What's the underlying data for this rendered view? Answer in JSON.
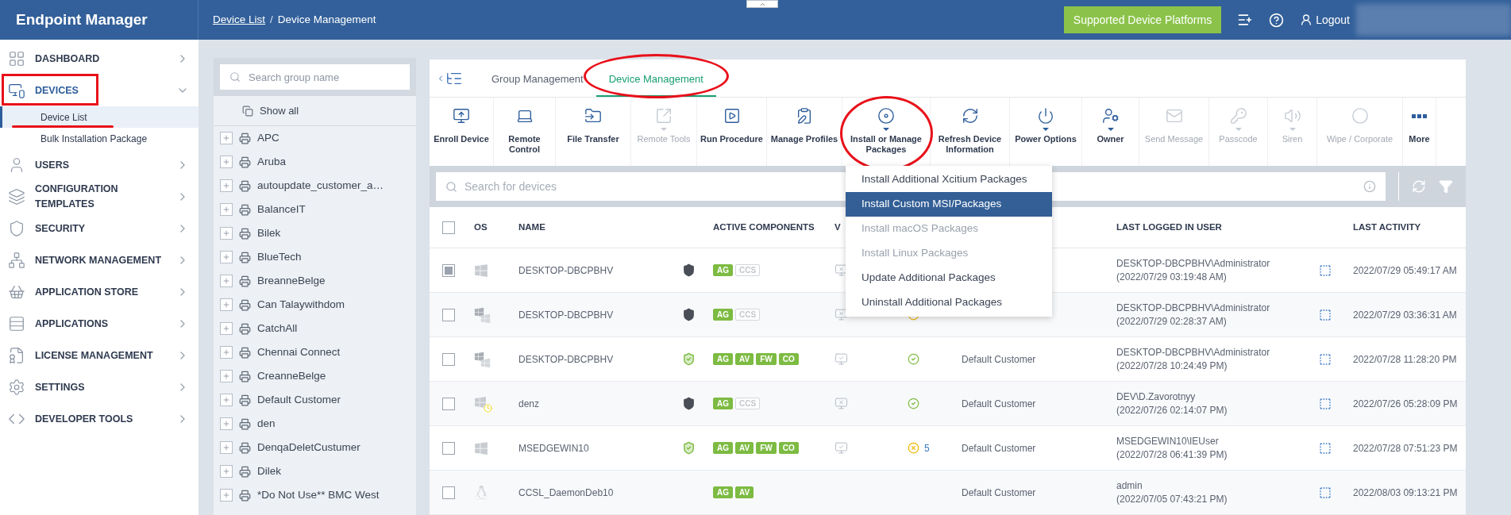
{
  "header": {
    "logo": "Endpoint Manager",
    "breadcrumb": [
      {
        "label": "Device List",
        "link": true
      },
      {
        "label": "Device Management",
        "link": false
      }
    ],
    "separator": "/",
    "platforms_button": "Supported Device Platforms",
    "logout": "Logout"
  },
  "sidebar": {
    "items": [
      {
        "label": "DASHBOARD",
        "selected": false,
        "expanded": false,
        "annotated": false
      },
      {
        "label": "DEVICES",
        "selected": true,
        "expanded": true,
        "annotated": true,
        "children": [
          {
            "label": "Device List",
            "selected": true,
            "annotated": true
          },
          {
            "label": "Bulk Installation Package",
            "selected": false,
            "annotated": false
          }
        ]
      },
      {
        "label": "USERS",
        "selected": false,
        "expanded": false,
        "annotated": false
      },
      {
        "label": "CONFIGURATION TEMPLATES",
        "selected": false,
        "expanded": false,
        "annotated": false
      },
      {
        "label": "SECURITY",
        "selected": false,
        "expanded": false,
        "annotated": false
      },
      {
        "label": "NETWORK MANAGEMENT",
        "selected": false,
        "expanded": false,
        "annotated": false
      },
      {
        "label": "APPLICATION STORE",
        "selected": false,
        "expanded": false,
        "annotated": false
      },
      {
        "label": "APPLICATIONS",
        "selected": false,
        "expanded": false,
        "annotated": false
      },
      {
        "label": "LICENSE MANAGEMENT",
        "selected": false,
        "expanded": false,
        "annotated": false
      },
      {
        "label": "SETTINGS",
        "selected": false,
        "expanded": false,
        "annotated": false
      },
      {
        "label": "DEVELOPER TOOLS",
        "selected": false,
        "expanded": false,
        "annotated": false
      }
    ]
  },
  "groups": {
    "search": {
      "placeholder": "Search group name"
    },
    "show_all": "Show all",
    "items": [
      "APC",
      "Aruba",
      "autoupdate_customer_a…",
      "BalanceIT",
      "Bilek",
      "BlueTech",
      "BreanneBelge",
      "Can Talaywithdom",
      "CatchAll",
      "Chennai Connect",
      "CreanneBelge",
      "Default Customer",
      "den",
      "DenqaDeletCustumer",
      "Dilek",
      "*Do Not Use** BMC West"
    ]
  },
  "tabs": [
    {
      "label": "Group Management",
      "selected": false,
      "annotated": false
    },
    {
      "label": "Device Management",
      "selected": true,
      "annotated": true
    }
  ],
  "toolbar": [
    {
      "label": "Enroll Device",
      "disabled": false,
      "dropdown": false,
      "annotated": false
    },
    {
      "label": "Remote Control",
      "disabled": false,
      "dropdown": false,
      "annotated": false
    },
    {
      "label": "File Transfer",
      "disabled": false,
      "dropdown": false,
      "annotated": false
    },
    {
      "label": "Remote Tools",
      "disabled": true,
      "dropdown": true,
      "annotated": false
    },
    {
      "label": "Run Procedure",
      "disabled": false,
      "dropdown": false,
      "annotated": false
    },
    {
      "label": "Manage Profiles",
      "disabled": false,
      "dropdown": false,
      "annotated": false
    },
    {
      "label": "Install or Manage Packages",
      "disabled": false,
      "dropdown": true,
      "annotated": true
    },
    {
      "label": "Refresh Device Information",
      "disabled": false,
      "dropdown": false,
      "annotated": false
    },
    {
      "label": "Power Options",
      "disabled": false,
      "dropdown": true,
      "annotated": false
    },
    {
      "label": "Owner",
      "disabled": false,
      "dropdown": true,
      "annotated": false
    },
    {
      "label": "Send Message",
      "disabled": true,
      "dropdown": false,
      "annotated": false
    },
    {
      "label": "Passcode",
      "disabled": true,
      "dropdown": true,
      "annotated": false
    },
    {
      "label": "Siren",
      "disabled": true,
      "dropdown": true,
      "annotated": false
    },
    {
      "label": "Wipe / Corporate",
      "disabled": true,
      "dropdown": false,
      "annotated": false
    },
    {
      "label": "More",
      "disabled": false,
      "dropdown": false,
      "annotated": false
    }
  ],
  "device_search": {
    "placeholder": "Search for devices"
  },
  "package_menu": [
    {
      "label": "Install Additional Xcitium Packages",
      "selected": false,
      "disabled": false
    },
    {
      "label": "Install Custom MSI/Packages",
      "selected": true,
      "disabled": false
    },
    {
      "label": "Install macOS Packages",
      "selected": false,
      "disabled": true
    },
    {
      "label": "Install Linux Packages",
      "selected": false,
      "disabled": true
    },
    {
      "label": "Update Additional Packages",
      "selected": false,
      "disabled": false
    },
    {
      "label": "Uninstall Additional Packages",
      "selected": false,
      "disabled": false
    }
  ],
  "table": {
    "select_all_checked": false,
    "columns": {
      "os": "OS",
      "name": "NAME",
      "components": "ACTIVE COMPONENTS",
      "column_6": "V",
      "user": "LAST LOGGED IN USER",
      "activity": "LAST ACTIVITY"
    },
    "rows": [
      {
        "selected": true,
        "os": {
          "kind": "windows"
        },
        "name": "DESKTOP-DBCPBHV",
        "protection": {
          "kind": "partial"
        },
        "components": [
          {
            "label": "AG",
            "active": true
          },
          {
            "label": "CCS",
            "active": false
          }
        ],
        "desktop": {
          "kind": "disconnected"
        },
        "user": "DESKTOP-DBCPBHV\\Administrator",
        "user_time": "(2022/07/29 03:19:48 AM)",
        "activity": "2022/07/29 05:49:17 AM"
      },
      {
        "selected": false,
        "os": {
          "kind": "windows-multi"
        },
        "name": "DESKTOP-DBCPBHV",
        "protection": {
          "kind": "partial"
        },
        "components": [
          {
            "label": "AG",
            "active": true
          },
          {
            "label": "CCS",
            "active": false
          }
        ],
        "desktop": {
          "kind": "disconnected"
        },
        "status": {
          "kind": "warning"
        },
        "user": "DESKTOP-DBCPBHV\\Administrator",
        "user_time": "(2022/07/29 02:28:37 AM)",
        "activity": "2022/07/29 03:36:31 AM"
      },
      {
        "selected": false,
        "os": {
          "kind": "windows-multi"
        },
        "name": "DESKTOP-DBCPBHV",
        "protection": {
          "kind": "protected"
        },
        "components": [
          {
            "label": "AG",
            "active": true
          },
          {
            "label": "AV",
            "active": true
          },
          {
            "label": "FW",
            "active": true
          },
          {
            "label": "CO",
            "active": true
          }
        ],
        "desktop": {
          "kind": "connected"
        },
        "status": {
          "kind": "ok"
        },
        "customer": "Default Customer",
        "user": "DESKTOP-DBCPBHV\\Administrator",
        "user_time": "(2022/07/28 10:24:49 PM)",
        "activity": "2022/07/28 11:28:20 PM"
      },
      {
        "selected": false,
        "os": {
          "kind": "windows-pending"
        },
        "name": "denz",
        "protection": {
          "kind": "partial"
        },
        "components": [
          {
            "label": "AG",
            "active": true
          },
          {
            "label": "CCS",
            "active": false
          }
        ],
        "desktop": {
          "kind": "disconnected"
        },
        "status": {
          "kind": "ok"
        },
        "customer": "Default Customer",
        "user": "DEV\\D.Zavorotnyy",
        "user_time": "(2022/07/26 02:14:07 PM)",
        "activity": "2022/07/26 05:28:09 PM"
      },
      {
        "selected": false,
        "os": {
          "kind": "windows"
        },
        "name": "MSEDGEWIN10",
        "protection": {
          "kind": "protected"
        },
        "components": [
          {
            "label": "AG",
            "active": true
          },
          {
            "label": "AV",
            "active": true
          },
          {
            "label": "FW",
            "active": true
          },
          {
            "label": "CO",
            "active": true
          }
        ],
        "desktop": {
          "kind": "connected"
        },
        "status": {
          "kind": "warning",
          "count": "5"
        },
        "customer": "Default Customer",
        "user": "MSEDGEWIN10\\IEUser",
        "user_time": "(2022/07/28 06:41:39 PM)",
        "activity": "2022/07/28 07:51:23 PM"
      },
      {
        "selected": false,
        "os": {
          "kind": "linux"
        },
        "name": "CCSL_DaemonDeb10",
        "protection": {
          "kind": "none"
        },
        "components": [
          {
            "label": "AG",
            "active": true
          },
          {
            "label": "AV",
            "active": true
          }
        ],
        "customer": "Default Customer",
        "user": "admin",
        "user_time": "(2022/07/05 07:43:21 PM)",
        "activity": "2022/08/03 09:13:21 PM"
      }
    ]
  }
}
